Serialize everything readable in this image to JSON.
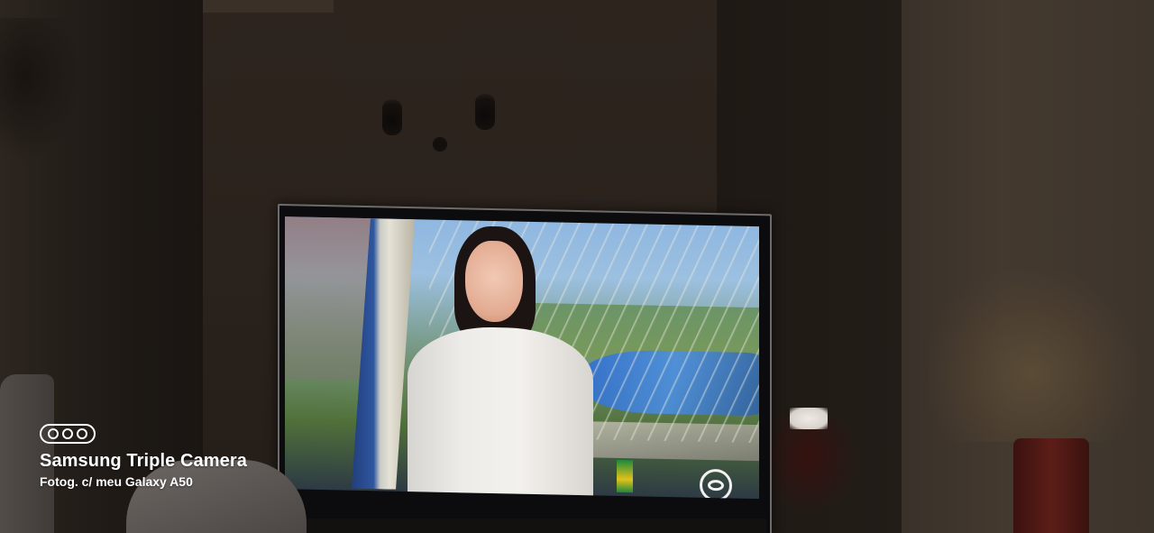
{
  "watermark": {
    "icon": "triple-camera-icon",
    "title": "Samsung Triple Camera",
    "subtitle": "Fotog. c/ meu Galaxy A50"
  },
  "broadcast": {
    "channel_logo": "globo-logo"
  },
  "colors": {
    "watermark_text": "#ffffff",
    "wall": "#2a221c",
    "tv_frame": "#6f6b6a"
  }
}
